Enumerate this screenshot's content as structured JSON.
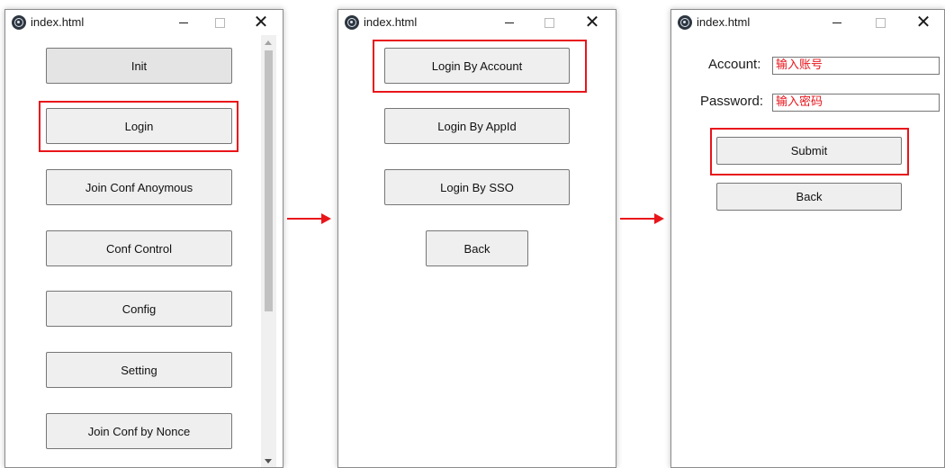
{
  "panels": [
    {
      "title": "index.html",
      "buttons": [
        "Init",
        "Login",
        "Join Conf Anoymous",
        "Conf Control",
        "Config",
        "Setting",
        "Join Conf by Nonce"
      ]
    },
    {
      "title": "index.html",
      "buttons": [
        "Login By Account",
        "Login By AppId",
        "Login By SSO",
        "Back"
      ]
    },
    {
      "title": "index.html",
      "account_label": "Account:",
      "account_placeholder": "输入账号",
      "password_label": "Password:",
      "password_placeholder": "输入密码",
      "submit_label": "Submit",
      "back_label": "Back"
    }
  ],
  "window_controls": {
    "close": "✕"
  },
  "colors": {
    "highlight": "#e8151b",
    "arrow": "#e8151b",
    "button_bg": "#efefef"
  }
}
